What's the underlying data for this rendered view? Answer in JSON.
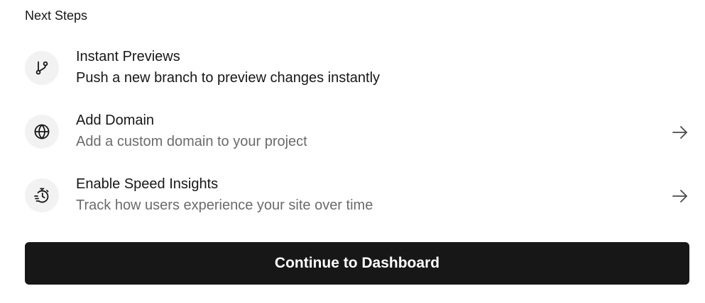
{
  "next_steps": {
    "title": "Next Steps",
    "items": [
      {
        "icon": "git-branch-icon",
        "title": "Instant Previews",
        "description": "Push a new branch to preview changes instantly",
        "has_arrow": false
      },
      {
        "icon": "globe-icon",
        "title": "Add Domain",
        "description": "Add a custom domain to your project",
        "has_arrow": true
      },
      {
        "icon": "stopwatch-speed-icon",
        "title": "Enable Speed Insights",
        "description": "Track how users experience your site over time",
        "has_arrow": true
      }
    ]
  },
  "cta": {
    "label": "Continue to Dashboard"
  },
  "colors": {
    "text_primary": "#171717",
    "text_secondary": "#6b6b6b",
    "icon_bg": "#f2f2f2",
    "button_bg": "#171717",
    "button_text": "#ffffff"
  }
}
